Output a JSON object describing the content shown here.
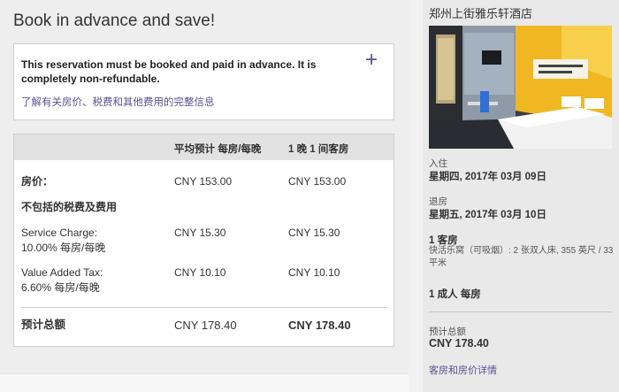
{
  "booking": {
    "heading": "Book in advance and save!",
    "notice_text": "This reservation must be booked and paid in advance. It is completely non-refundable.",
    "notice_expand": "+",
    "notice_link": "了解有关房价、税费和其他费用的完整信息"
  },
  "price_table": {
    "col_avg": "平均预计 每房/每晚",
    "col_total": "1 晚 1 间客房",
    "rate_label": "房价：",
    "rate_avg": "CNY 153.00",
    "rate_total": "CNY 153.00",
    "excluded_label": "不包括的税费及费用",
    "service_label_1": "Service Charge:",
    "service_label_2": "10.00% 每房/每晚",
    "service_avg": "CNY 15.30",
    "service_total": "CNY 15.30",
    "vat_label_1": "Value Added Tax:",
    "vat_label_2": "6.60% 每房/每晚",
    "vat_avg": "CNY 10.10",
    "vat_total": "CNY 10.10",
    "estimated_label": "预计总额",
    "estimated_avg": "CNY 178.40",
    "estimated_total": "CNY 178.40"
  },
  "summary": {
    "hotel_name": "郑州上街雅乐轩酒店",
    "checkin_label": "入住",
    "checkin_date": "星期四, 2017年 03月 09日",
    "checkout_label": "退房",
    "checkout_date": "星期五, 2017年 03月 10日",
    "rooms": "1 客房",
    "room_desc": "快活乐窝（可吸烟）: 2 张双人床, 355 英尺 / 33 平米",
    "guests": "1 成人 每房",
    "total_label": "预计总额",
    "total_value": "CNY 178.40",
    "details_link": "客房和房价详情"
  },
  "colors": {
    "link": "#5c4f91",
    "accent_wall": "#f0b722"
  },
  "icons": {
    "expand": "plus-icon"
  }
}
